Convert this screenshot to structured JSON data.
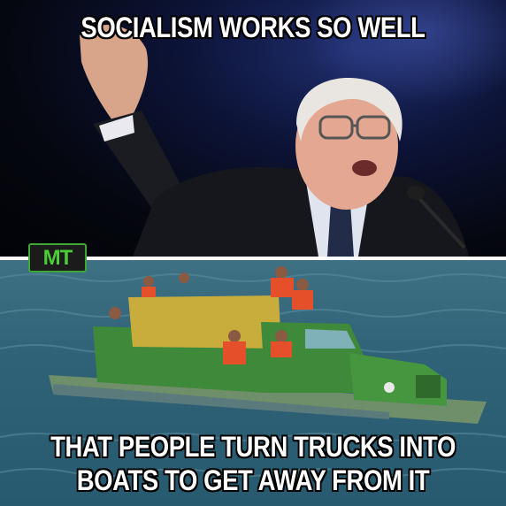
{
  "meme": {
    "top_caption": "SOCIALISM WORKS SO WELL",
    "bottom_caption_line1": "THAT PEOPLE TURN TRUCKS INTO",
    "bottom_caption_line2": "BOATS TO GET AWAY FROM IT",
    "logo_text": "MT"
  },
  "colors": {
    "caption_text": "#ffffff",
    "caption_outline": "#000000",
    "truck_green": "#3f8a3a",
    "tarp_yellow": "#c9ad3c",
    "sea": "#2f6277",
    "logo_green": "#4ccd38"
  }
}
